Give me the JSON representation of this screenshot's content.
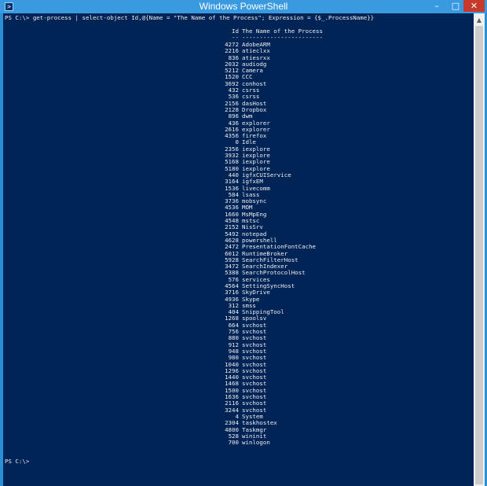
{
  "window": {
    "title": "Windows PowerShell",
    "icon": "powershell-icon",
    "controls": {
      "minimize": "–",
      "maximize": "□",
      "close": "✕"
    }
  },
  "console": {
    "command": "PS C:\\> get-process | select-object Id,@{Name = \"The Name of the Process\"; Expression = {$_.ProcessName}}",
    "headers": {
      "id": "Id",
      "name": "The Name of the Process"
    },
    "underline": {
      "id": "--",
      "name": "-----------------------"
    },
    "rows": [
      {
        "id": "4272",
        "name": "AdobeARM"
      },
      {
        "id": "2216",
        "name": "atieclxx"
      },
      {
        "id": "836",
        "name": "atiesrxx"
      },
      {
        "id": "2032",
        "name": "audiodg"
      },
      {
        "id": "5212",
        "name": "Camera"
      },
      {
        "id": "1520",
        "name": "CCC"
      },
      {
        "id": "3692",
        "name": "conhost"
      },
      {
        "id": "432",
        "name": "csrss"
      },
      {
        "id": "536",
        "name": "csrss"
      },
      {
        "id": "2156",
        "name": "dasHost"
      },
      {
        "id": "2128",
        "name": "Dropbox"
      },
      {
        "id": "896",
        "name": "dwm"
      },
      {
        "id": "436",
        "name": "explorer"
      },
      {
        "id": "2616",
        "name": "explorer"
      },
      {
        "id": "4356",
        "name": "firefox"
      },
      {
        "id": "0",
        "name": "Idle"
      },
      {
        "id": "2356",
        "name": "iexplore"
      },
      {
        "id": "3932",
        "name": "iexplore"
      },
      {
        "id": "5168",
        "name": "iexplore"
      },
      {
        "id": "5180",
        "name": "iexplore"
      },
      {
        "id": "440",
        "name": "igfxCUIService"
      },
      {
        "id": "3164",
        "name": "igfxEM"
      },
      {
        "id": "1536",
        "name": "livecomm"
      },
      {
        "id": "584",
        "name": "lsass"
      },
      {
        "id": "3736",
        "name": "mobsync"
      },
      {
        "id": "4536",
        "name": "MOM"
      },
      {
        "id": "1660",
        "name": "MsMpEng"
      },
      {
        "id": "4548",
        "name": "mstsc"
      },
      {
        "id": "2152",
        "name": "NisSrv"
      },
      {
        "id": "5492",
        "name": "notepad"
      },
      {
        "id": "4628",
        "name": "powershell"
      },
      {
        "id": "2472",
        "name": "PresentationFontCache"
      },
      {
        "id": "6012",
        "name": "RuntimeBroker"
      },
      {
        "id": "5928",
        "name": "SearchFilterHost"
      },
      {
        "id": "3472",
        "name": "SearchIndexer"
      },
      {
        "id": "5388",
        "name": "SearchProtocolHost"
      },
      {
        "id": "576",
        "name": "services"
      },
      {
        "id": "4564",
        "name": "SettingSyncHost"
      },
      {
        "id": "3716",
        "name": "SkyDrive"
      },
      {
        "id": "4936",
        "name": "Skype"
      },
      {
        "id": "312",
        "name": "smss"
      },
      {
        "id": "404",
        "name": "SnippingTool"
      },
      {
        "id": "1268",
        "name": "spoolsv"
      },
      {
        "id": "664",
        "name": "svchost"
      },
      {
        "id": "756",
        "name": "svchost"
      },
      {
        "id": "880",
        "name": "svchost"
      },
      {
        "id": "912",
        "name": "svchost"
      },
      {
        "id": "948",
        "name": "svchost"
      },
      {
        "id": "980",
        "name": "svchost"
      },
      {
        "id": "1040",
        "name": "svchost"
      },
      {
        "id": "1296",
        "name": "svchost"
      },
      {
        "id": "1440",
        "name": "svchost"
      },
      {
        "id": "1468",
        "name": "svchost"
      },
      {
        "id": "1500",
        "name": "svchost"
      },
      {
        "id": "1636",
        "name": "svchost"
      },
      {
        "id": "2116",
        "name": "svchost"
      },
      {
        "id": "3244",
        "name": "svchost"
      },
      {
        "id": "4",
        "name": "System"
      },
      {
        "id": "2304",
        "name": "taskhostex"
      },
      {
        "id": "4800",
        "name": "Taskmgr"
      },
      {
        "id": "528",
        "name": "wininit"
      },
      {
        "id": "700",
        "name": "winlogon"
      }
    ],
    "prompt": "PS C:\\>"
  },
  "colors": {
    "console_background": "#012456",
    "console_text": "#eeedf0",
    "titlebar": "#3a9ae0",
    "close_button": "#c7392a"
  }
}
